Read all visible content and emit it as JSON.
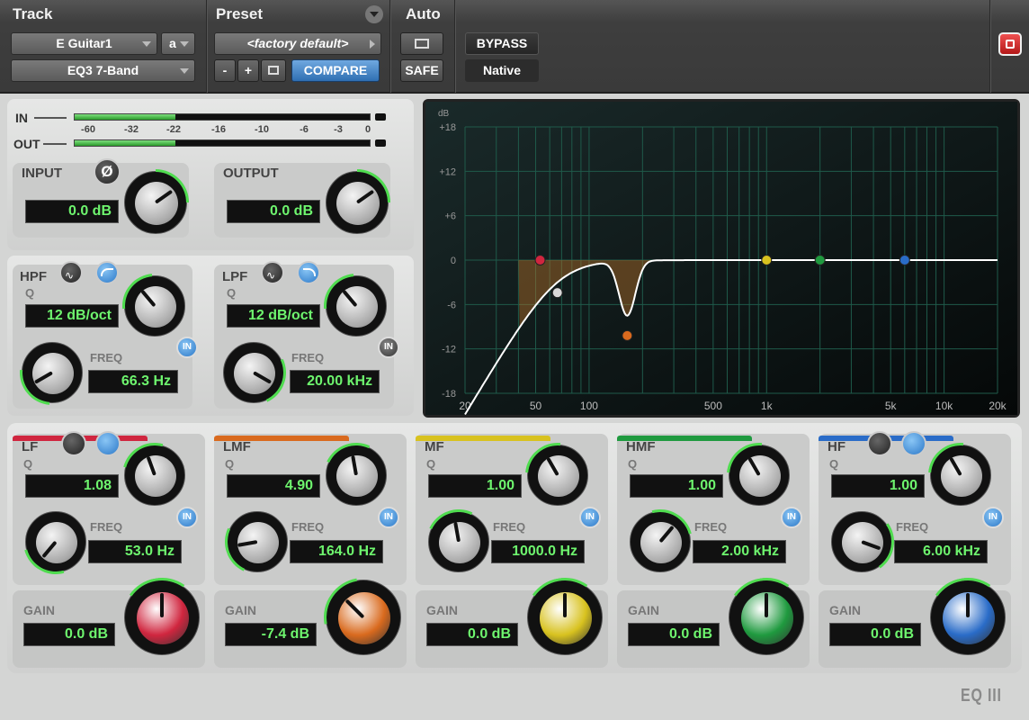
{
  "header": {
    "track_label": "Track",
    "preset_label": "Preset",
    "auto_label": "Auto",
    "track_name": "E Guitar1",
    "channel": "a",
    "plugin_name": "EQ3 7-Band",
    "preset_name": "<factory default>",
    "minus_label": "-",
    "plus_label": "+",
    "compare_label": "COMPARE",
    "safe_label": "SAFE",
    "bypass_label": "BYPASS",
    "native_label": "Native"
  },
  "meters": {
    "in_label": "IN",
    "out_label": "OUT",
    "scale": [
      "-60",
      "-32",
      "-22",
      "-16",
      "-10",
      "-6",
      "-3",
      "0"
    ],
    "in_level": 0.34,
    "out_level": 0.34
  },
  "input": {
    "title": "INPUT",
    "value": "0.0 dB",
    "phase_symbol": "Ø"
  },
  "output": {
    "title": "OUTPUT",
    "value": "0.0 dB"
  },
  "hpf": {
    "title": "HPF",
    "q_label": "Q",
    "slope": "12 dB/oct",
    "freq_label": "FREQ",
    "freq": "66.3 Hz",
    "in_label": "IN",
    "enabled": true
  },
  "lpf": {
    "title": "LPF",
    "q_label": "Q",
    "slope": "12 dB/oct",
    "freq_label": "FREQ",
    "freq": "20.00 kHz",
    "in_label": "IN",
    "enabled": false
  },
  "bands": [
    {
      "title": "LF",
      "color": "#d0263f",
      "q_label": "Q",
      "q": "1.08",
      "freq_label": "FREQ",
      "freq": "53.0 Hz",
      "gain_label": "GAIN",
      "gain": "0.0 dB",
      "in_label": "IN"
    },
    {
      "title": "LMF",
      "color": "#d96a1e",
      "q_label": "Q",
      "q": "4.90",
      "freq_label": "FREQ",
      "freq": "164.0 Hz",
      "gain_label": "GAIN",
      "gain": "-7.4 dB",
      "in_label": "IN"
    },
    {
      "title": "MF",
      "color": "#d8c21f",
      "q_label": "Q",
      "q": "1.00",
      "freq_label": "FREQ",
      "freq": "1000.0 Hz",
      "gain_label": "GAIN",
      "gain": "0.0 dB",
      "in_label": "IN"
    },
    {
      "title": "HMF",
      "color": "#1f9a3f",
      "q_label": "Q",
      "q": "1.00",
      "freq_label": "FREQ",
      "freq": "2.00 kHz",
      "gain_label": "GAIN",
      "gain": "0.0 dB",
      "in_label": "IN"
    },
    {
      "title": "HF",
      "color": "#2a6cc8",
      "q_label": "Q",
      "q": "1.00",
      "freq_label": "FREQ",
      "freq": "6.00 kHz",
      "gain_label": "GAIN",
      "gain": "0.0 dB",
      "in_label": "IN"
    }
  ],
  "graph": {
    "db_unit": "dB",
    "y_ticks": [
      "+18",
      "+12",
      "+6",
      "0",
      "-6",
      "-12",
      "-18"
    ],
    "x_ticks": [
      "20",
      "50",
      "100",
      "500",
      "1k",
      "5k",
      "10k",
      "20k"
    ]
  },
  "logo": "EQ III"
}
